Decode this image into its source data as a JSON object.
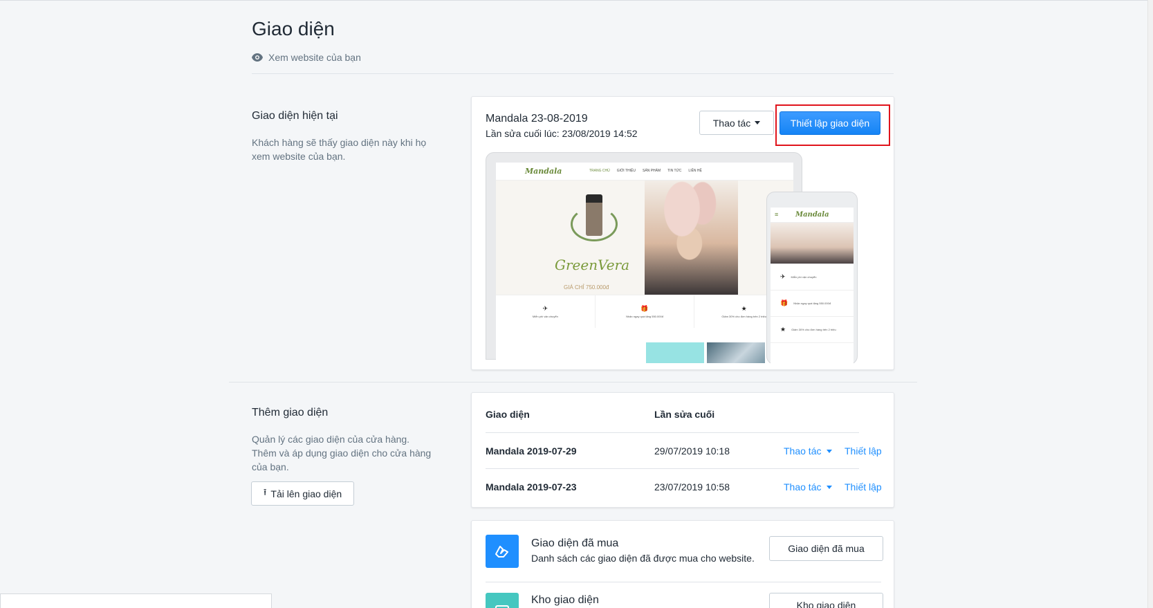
{
  "header": {
    "title": "Giao diện",
    "view_link": "Xem website của bạn"
  },
  "current_section": {
    "title": "Giao diện hiện tại",
    "description_line1": "Khách hàng sẽ thấy giao diện này khi họ",
    "description_line2": "xem website của bạn.",
    "theme_name": "Mandala 23-08-2019",
    "last_edit": "Lần sửa cuối lúc: 23/08/2019 14:52",
    "actions_label": "Thao tác",
    "setup_label": "Thiết lập giao diện",
    "preview": {
      "logo": "Mandala",
      "menu": [
        "TRANG CHỦ",
        "GIỚI THIỆU",
        "SẢN PHẨM",
        "TIN TỨC",
        "LIÊN HỆ"
      ],
      "hero_text": "GreenVera",
      "price": "GIÁ CHỈ 750.000đ",
      "features": [
        "Miễn phí vận chuyển",
        "Nhận ngay quà tặng 550.000đ",
        "Giảm 30% cho đơn hàng trên 2 triệu"
      ],
      "phone_features": [
        "Miễn phí vận chuyển",
        "Nhận ngay quà tặng 550.000đ",
        "Giảm 30% cho đơn hàng trên 2 triệu"
      ]
    }
  },
  "add_section": {
    "title": "Thêm giao diện",
    "description_line1": "Quản lý các giao diện của cửa hàng.",
    "description_line2": "Thêm và áp dụng giao diện cho cửa hàng",
    "description_line3": "của bạn.",
    "upload_label": "Tải lên giao diện",
    "table": {
      "col_theme": "Giao diện",
      "col_last_edit": "Lần sửa cuối",
      "rows": [
        {
          "name": "Mandala 2019-07-29",
          "edited": "29/07/2019 10:18",
          "actions": "Thao tác",
          "setup": "Thiết lập"
        },
        {
          "name": "Mandala 2019-07-23",
          "edited": "23/07/2019 10:58",
          "actions": "Thao tác",
          "setup": "Thiết lập"
        }
      ]
    }
  },
  "store_section": {
    "purchased": {
      "title": "Giao diện đã mua",
      "description": "Danh sách các giao diện đã được mua cho website.",
      "button": "Giao diện đã mua"
    },
    "store": {
      "title": "Kho giao diện",
      "button": "Kho giao diện"
    }
  },
  "colors": {
    "primary": "#1f8fff",
    "highlight": "#e0131b",
    "store_icon": "#45c7c0"
  }
}
